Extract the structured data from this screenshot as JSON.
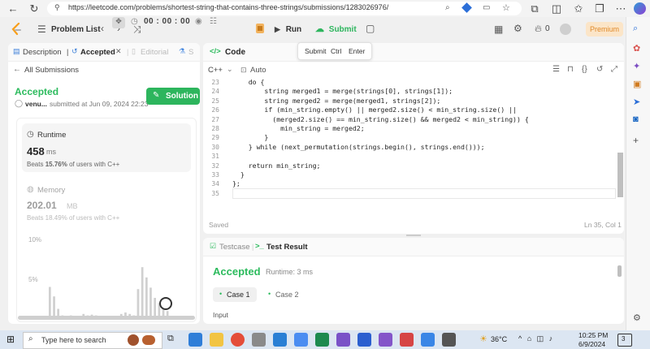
{
  "browser": {
    "url": "https://leetcode.com/problems/shortest-string-that-contains-three-strings/submissions/1283026976/"
  },
  "header": {
    "problem_list": "Problem List",
    "timer": "00 : 00 : 00",
    "run": "Run",
    "submit": "Submit",
    "streak": "0",
    "premium": "Premium"
  },
  "tooltip": {
    "submit": "Submit",
    "ctrl": "Ctrl",
    "enter": "Enter"
  },
  "left": {
    "tabs": [
      "Description",
      "Accepted",
      "Editorial",
      "S"
    ],
    "all_submissions": "All Submissions",
    "status": "Accepted",
    "user": "venu...",
    "submitted": "submitted at Jun 09, 2024 22:23",
    "solution_btn": "Solution",
    "runtime_label": "Runtime",
    "runtime_value": "458",
    "runtime_unit": "ms",
    "runtime_beats_prefix": "Beats",
    "runtime_beats_pct": "15.76%",
    "runtime_beats_suffix": "of users with C++",
    "memory_label": "Memory",
    "memory_value": "202.01",
    "memory_unit": "MB",
    "memory_beats": "Beats 18.49% of users with C++",
    "chart_y1": "10%",
    "chart_y2": "5%"
  },
  "chart_data": {
    "type": "bar",
    "ylabel": "",
    "ylim": [
      0,
      12
    ],
    "ticks": [
      "10%",
      "5%"
    ],
    "values": [
      4.5,
      3.2,
      1.5,
      0.6,
      0.5,
      0.6,
      0.5,
      0.5,
      0.8,
      0.6,
      0.7,
      0.6,
      0.5,
      0.5,
      0.5,
      0.5,
      0.5,
      0.8,
      1.0,
      0.8,
      0.6,
      4.2,
      7.2,
      5.8,
      4.4,
      3.0,
      2.3,
      1.6,
      1.2
    ]
  },
  "code": {
    "title": "Code",
    "language": "C++",
    "auto": "Auto",
    "saved": "Saved",
    "cursor": "Ln 35, Col 1",
    "lines": [
      {
        "n": "23",
        "text": "    do {"
      },
      {
        "n": "24",
        "text": "        string merged1 = merge(strings[0], strings[1]);"
      },
      {
        "n": "25",
        "text": "        string merged2 = merge(merged1, strings[2]);"
      },
      {
        "n": "26",
        "text": "        if (min_string.empty() || merged2.size() < min_string.size() ||"
      },
      {
        "n": "27",
        "text": "          (merged2.size() == min_string.size() && merged2 < min_string)) {"
      },
      {
        "n": "28",
        "text": "            min_string = merged2;"
      },
      {
        "n": "29",
        "text": "        }"
      },
      {
        "n": "30",
        "text": "    } while (next_permutation(strings.begin(), strings.end()));"
      },
      {
        "n": "31",
        "text": ""
      },
      {
        "n": "32",
        "text": "    return min_string;"
      },
      {
        "n": "33",
        "text": "  }"
      },
      {
        "n": "34",
        "text": "};"
      },
      {
        "n": "35",
        "text": ""
      }
    ]
  },
  "result": {
    "tab_testcase": "Testcase",
    "tab_result": "Test Result",
    "status": "Accepted",
    "runtime": "Runtime: 3 ms",
    "case1": "Case 1",
    "case2": "Case 2",
    "input_label": "Input"
  },
  "taskbar": {
    "search_placeholder": "Type here to search",
    "temp": "36°C",
    "time": "10:25 PM",
    "date": "6/9/2024",
    "notif": "3"
  },
  "colors": {
    "accent_green": "#2db55d",
    "accept_green": "#2cbb5d",
    "orange": "#e08a2a"
  }
}
